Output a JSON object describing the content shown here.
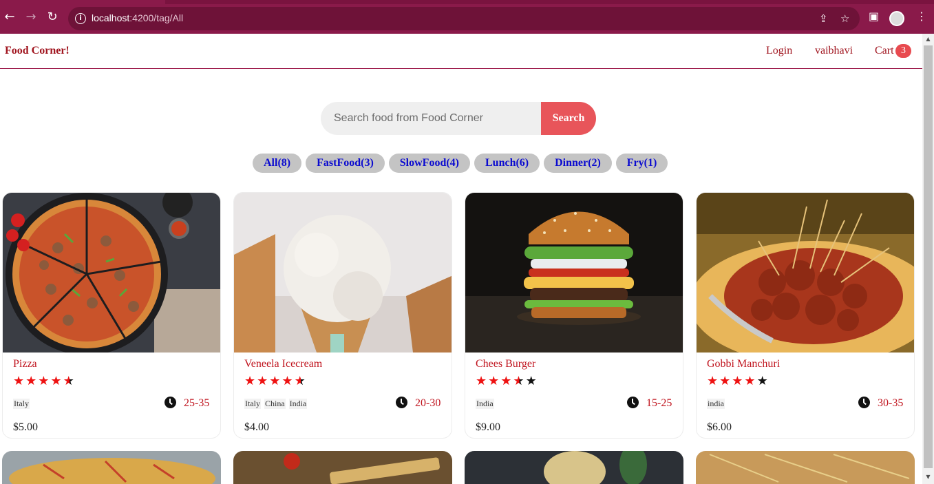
{
  "browser": {
    "url_host": "localhost",
    "url_path": ":4200/tag/All"
  },
  "header": {
    "logo": "Food Corner!",
    "login_label": "Login",
    "user_label": "vaibhavi",
    "cart_label": "Cart",
    "cart_count": "3"
  },
  "search": {
    "placeholder": "Search food from Food Corner",
    "button_label": "Search"
  },
  "tags": [
    "All(8)",
    "FastFood(3)",
    "SlowFood(4)",
    "Lunch(6)",
    "Dinner(2)",
    "Fry(1)"
  ],
  "foods": [
    {
      "name": "Pizza",
      "rating": 4.5,
      "origins": [
        "Italy"
      ],
      "cook_time": "25-35",
      "price": "$5.00"
    },
    {
      "name": "Veneela Icecream",
      "rating": 4.5,
      "origins": [
        "Italy",
        "China",
        "India"
      ],
      "cook_time": "20-30",
      "price": "$4.00"
    },
    {
      "name": "Chees Burger",
      "rating": 3.5,
      "origins": [
        "India"
      ],
      "cook_time": "15-25",
      "price": "$9.00"
    },
    {
      "name": "Gobbi Manchuri",
      "rating": 4,
      "origins": [
        "india"
      ],
      "cook_time": "30-35",
      "price": "$6.00"
    }
  ],
  "colors": {
    "browser_bar": "#8a1a4a",
    "brand_red": "#a0141e",
    "search_button": "#e8555a",
    "tag_text": "#0b0bd0",
    "star": "#ee1111"
  }
}
